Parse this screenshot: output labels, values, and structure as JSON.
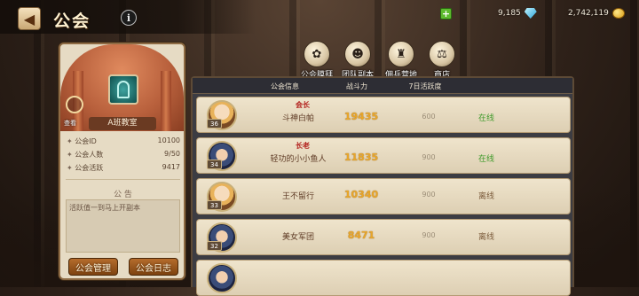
{
  "header": {
    "back_icon": "back-arrow-icon",
    "title": "公会",
    "info_icon": "info-icon"
  },
  "currency": [
    {
      "icon": "gem-icon",
      "value": "9,185"
    },
    {
      "icon": "gold-coin-icon",
      "value": "2,742,119"
    }
  ],
  "functions": [
    {
      "label": "公会膜拜",
      "icon": "worship-icon"
    },
    {
      "label": "团队副本",
      "icon": "team-dungeon-icon"
    },
    {
      "label": "佣兵营地",
      "icon": "mercenary-camp-icon"
    },
    {
      "label": "商店",
      "icon": "shop-scales-icon"
    }
  ],
  "guild": {
    "search_label": "查看",
    "name": "A班教室",
    "stats": [
      {
        "label": "公会ID",
        "value": "10100"
      },
      {
        "label": "公会人数",
        "value": "9/50"
      },
      {
        "label": "公会活跃",
        "value": "9417"
      }
    ],
    "notice_title": "公 告",
    "notice_text": "活跃值一到马上开副本",
    "manage_button": "公会管理",
    "log_button": "公会日志"
  },
  "table": {
    "headers": [
      "公会信息",
      "战斗力",
      "7日活跃度"
    ],
    "rows": [
      {
        "level": "36",
        "role": "会长",
        "name": "斗神白帕",
        "power": "19435",
        "activity": "600",
        "status": "在线",
        "avatar": "blonde-hero"
      },
      {
        "level": "34",
        "role": "长老",
        "name": "轻功的小小鱼人",
        "power": "11835",
        "activity": "900",
        "status": "在线",
        "avatar": "pirate-hero"
      },
      {
        "level": "33",
        "role": "",
        "name": "王不留行",
        "power": "10340",
        "activity": "900",
        "status": "离线",
        "avatar": "blonde-hero"
      },
      {
        "level": "32",
        "role": "",
        "name": "美女军团",
        "power": "8471",
        "activity": "900",
        "status": "离线",
        "avatar": "pirate-hero"
      }
    ]
  },
  "colors": {
    "online": "#3f9a2a",
    "offline": "#7a5a3a",
    "power": "#e8a62a",
    "role": "#b3221e"
  }
}
